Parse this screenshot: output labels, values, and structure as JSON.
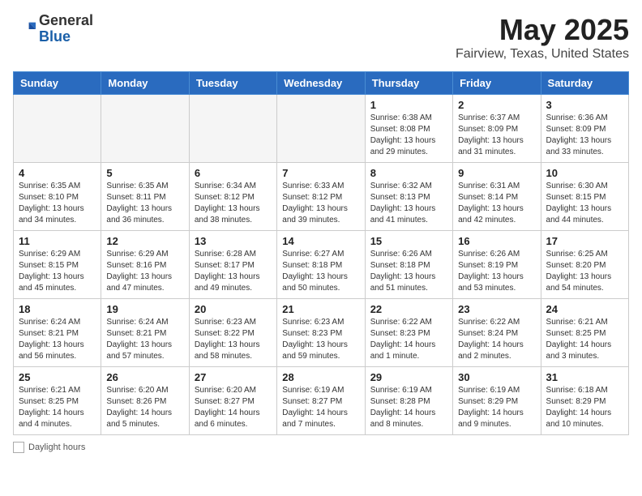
{
  "header": {
    "logo_general": "General",
    "logo_blue": "Blue",
    "main_title": "May 2025",
    "subtitle": "Fairview, Texas, United States"
  },
  "days_of_week": [
    "Sunday",
    "Monday",
    "Tuesday",
    "Wednesday",
    "Thursday",
    "Friday",
    "Saturday"
  ],
  "weeks": [
    [
      {
        "day": "",
        "sunrise": "",
        "sunset": "",
        "daylight": ""
      },
      {
        "day": "",
        "sunrise": "",
        "sunset": "",
        "daylight": ""
      },
      {
        "day": "",
        "sunrise": "",
        "sunset": "",
        "daylight": ""
      },
      {
        "day": "",
        "sunrise": "",
        "sunset": "",
        "daylight": ""
      },
      {
        "day": "1",
        "sunrise": "6:38 AM",
        "sunset": "8:08 PM",
        "daylight": "13 hours and 29 minutes."
      },
      {
        "day": "2",
        "sunrise": "6:37 AM",
        "sunset": "8:09 PM",
        "daylight": "13 hours and 31 minutes."
      },
      {
        "day": "3",
        "sunrise": "6:36 AM",
        "sunset": "8:09 PM",
        "daylight": "13 hours and 33 minutes."
      }
    ],
    [
      {
        "day": "4",
        "sunrise": "6:35 AM",
        "sunset": "8:10 PM",
        "daylight": "13 hours and 34 minutes."
      },
      {
        "day": "5",
        "sunrise": "6:35 AM",
        "sunset": "8:11 PM",
        "daylight": "13 hours and 36 minutes."
      },
      {
        "day": "6",
        "sunrise": "6:34 AM",
        "sunset": "8:12 PM",
        "daylight": "13 hours and 38 minutes."
      },
      {
        "day": "7",
        "sunrise": "6:33 AM",
        "sunset": "8:12 PM",
        "daylight": "13 hours and 39 minutes."
      },
      {
        "day": "8",
        "sunrise": "6:32 AM",
        "sunset": "8:13 PM",
        "daylight": "13 hours and 41 minutes."
      },
      {
        "day": "9",
        "sunrise": "6:31 AM",
        "sunset": "8:14 PM",
        "daylight": "13 hours and 42 minutes."
      },
      {
        "day": "10",
        "sunrise": "6:30 AM",
        "sunset": "8:15 PM",
        "daylight": "13 hours and 44 minutes."
      }
    ],
    [
      {
        "day": "11",
        "sunrise": "6:29 AM",
        "sunset": "8:15 PM",
        "daylight": "13 hours and 45 minutes."
      },
      {
        "day": "12",
        "sunrise": "6:29 AM",
        "sunset": "8:16 PM",
        "daylight": "13 hours and 47 minutes."
      },
      {
        "day": "13",
        "sunrise": "6:28 AM",
        "sunset": "8:17 PM",
        "daylight": "13 hours and 49 minutes."
      },
      {
        "day": "14",
        "sunrise": "6:27 AM",
        "sunset": "8:18 PM",
        "daylight": "13 hours and 50 minutes."
      },
      {
        "day": "15",
        "sunrise": "6:26 AM",
        "sunset": "8:18 PM",
        "daylight": "13 hours and 51 minutes."
      },
      {
        "day": "16",
        "sunrise": "6:26 AM",
        "sunset": "8:19 PM",
        "daylight": "13 hours and 53 minutes."
      },
      {
        "day": "17",
        "sunrise": "6:25 AM",
        "sunset": "8:20 PM",
        "daylight": "13 hours and 54 minutes."
      }
    ],
    [
      {
        "day": "18",
        "sunrise": "6:24 AM",
        "sunset": "8:21 PM",
        "daylight": "13 hours and 56 minutes."
      },
      {
        "day": "19",
        "sunrise": "6:24 AM",
        "sunset": "8:21 PM",
        "daylight": "13 hours and 57 minutes."
      },
      {
        "day": "20",
        "sunrise": "6:23 AM",
        "sunset": "8:22 PM",
        "daylight": "13 hours and 58 minutes."
      },
      {
        "day": "21",
        "sunrise": "6:23 AM",
        "sunset": "8:23 PM",
        "daylight": "13 hours and 59 minutes."
      },
      {
        "day": "22",
        "sunrise": "6:22 AM",
        "sunset": "8:23 PM",
        "daylight": "14 hours and 1 minute."
      },
      {
        "day": "23",
        "sunrise": "6:22 AM",
        "sunset": "8:24 PM",
        "daylight": "14 hours and 2 minutes."
      },
      {
        "day": "24",
        "sunrise": "6:21 AM",
        "sunset": "8:25 PM",
        "daylight": "14 hours and 3 minutes."
      }
    ],
    [
      {
        "day": "25",
        "sunrise": "6:21 AM",
        "sunset": "8:25 PM",
        "daylight": "14 hours and 4 minutes."
      },
      {
        "day": "26",
        "sunrise": "6:20 AM",
        "sunset": "8:26 PM",
        "daylight": "14 hours and 5 minutes."
      },
      {
        "day": "27",
        "sunrise": "6:20 AM",
        "sunset": "8:27 PM",
        "daylight": "14 hours and 6 minutes."
      },
      {
        "day": "28",
        "sunrise": "6:19 AM",
        "sunset": "8:27 PM",
        "daylight": "14 hours and 7 minutes."
      },
      {
        "day": "29",
        "sunrise": "6:19 AM",
        "sunset": "8:28 PM",
        "daylight": "14 hours and 8 minutes."
      },
      {
        "day": "30",
        "sunrise": "6:19 AM",
        "sunset": "8:29 PM",
        "daylight": "14 hours and 9 minutes."
      },
      {
        "day": "31",
        "sunrise": "6:18 AM",
        "sunset": "8:29 PM",
        "daylight": "14 hours and 10 minutes."
      }
    ]
  ],
  "footer": {
    "legend_label": "Daylight hours"
  }
}
